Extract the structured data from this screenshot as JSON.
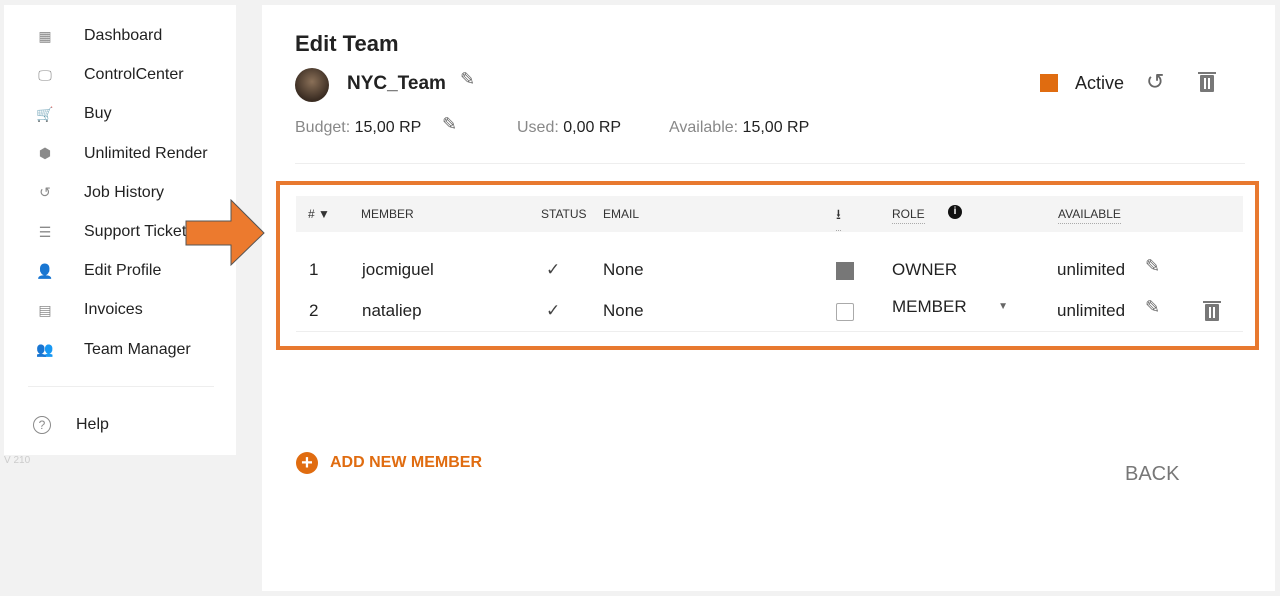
{
  "sidebar": {
    "items": [
      {
        "label": "Dashboard",
        "icon": "dashboard-icon",
        "glyph": "▦"
      },
      {
        "label": "ControlCenter",
        "icon": "monitor-icon",
        "glyph": "🖵"
      },
      {
        "label": "Buy",
        "icon": "cart-icon",
        "glyph": "🛒"
      },
      {
        "label": "Unlimited Render",
        "icon": "cube-icon",
        "glyph": "⬢"
      },
      {
        "label": "Job History",
        "icon": "history-icon",
        "glyph": "↺"
      },
      {
        "label": "Support Ticket",
        "icon": "checklist-icon",
        "glyph": "☰"
      },
      {
        "label": "Edit Profile",
        "icon": "user-edit-icon",
        "glyph": "👤"
      },
      {
        "label": "Invoices",
        "icon": "receipt-icon",
        "glyph": "▤"
      },
      {
        "label": "Team Manager",
        "icon": "team-icon",
        "glyph": "👥"
      }
    ],
    "help": "Help",
    "version": "V 210"
  },
  "main": {
    "title": "Edit Team",
    "team_name": "NYC_Team",
    "status": "Active",
    "status_color": "#e06c10",
    "budget_label": "Budget:",
    "budget": "15,00 RP",
    "used_label": "Used:",
    "used": "0,00 RP",
    "available_label": "Available:",
    "available": "15,00 RP",
    "table": {
      "headers": {
        "num": "#",
        "member": "MEMBER",
        "status": "STATUS",
        "email": "EMAIL",
        "role": "ROLE",
        "available": "AVAILABLE"
      },
      "rows": [
        {
          "num": "1",
          "member": "jocmiguel",
          "status": "✓",
          "email": "None",
          "download": true,
          "role": "OWNER",
          "available": "unlimited"
        },
        {
          "num": "2",
          "member": "nataliep",
          "status": "✓",
          "email": "None",
          "download": false,
          "role": "MEMBER",
          "available": "unlimited"
        }
      ]
    },
    "add_member": "ADD NEW MEMBER",
    "back": "BACK"
  },
  "accent": "#e8792f"
}
